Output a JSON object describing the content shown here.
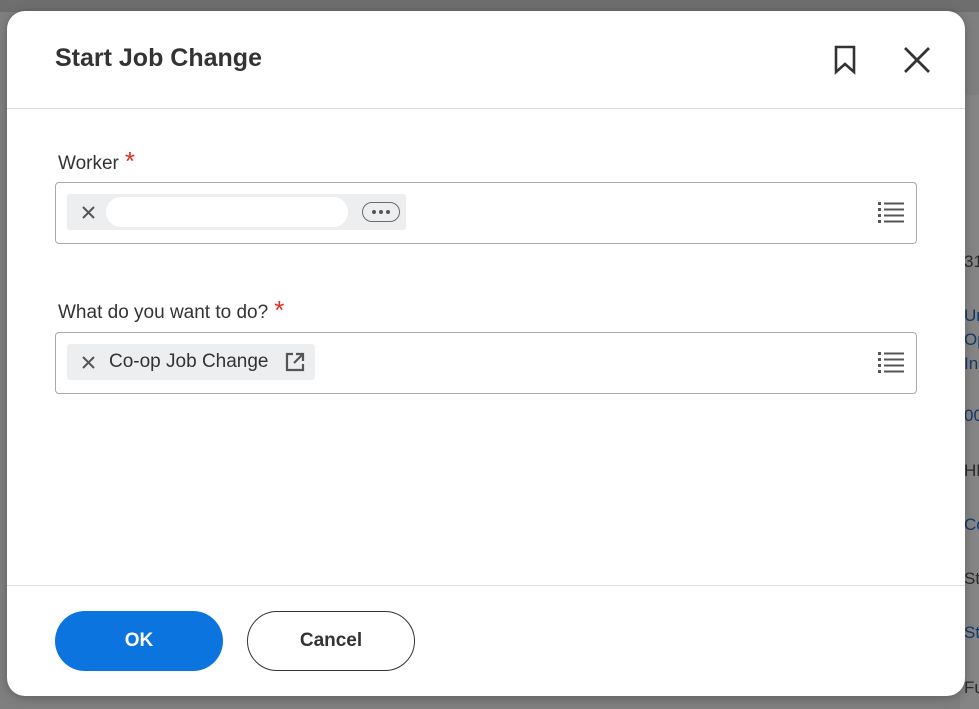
{
  "dialog": {
    "title": "Start Job Change",
    "bookmark_icon": "bookmark-icon",
    "close_icon": "close-icon"
  },
  "fields": {
    "worker": {
      "label": "Worker",
      "required_mark": "*",
      "selected_value": "",
      "remove_icon": "close-icon",
      "more_icon": "ellipsis-icon",
      "prompt_icon": "list-icon"
    },
    "action": {
      "label": "What do you want to do?",
      "required_mark": "*",
      "selected_value": "Co-op Job Change",
      "remove_icon": "close-icon",
      "open_icon": "external-link-icon",
      "prompt_icon": "list-icon"
    }
  },
  "footer": {
    "ok_label": "OK",
    "cancel_label": "Cancel"
  },
  "background_fragments": [
    "31",
    "Ur",
    "Op",
    "In",
    "00",
    "HF",
    "Co",
    "Sta",
    "Sta",
    "Fu"
  ],
  "colors": {
    "primary": "#0b74de",
    "required": "#de2e21",
    "text": "#333333",
    "pill_bg": "#eceef0"
  }
}
